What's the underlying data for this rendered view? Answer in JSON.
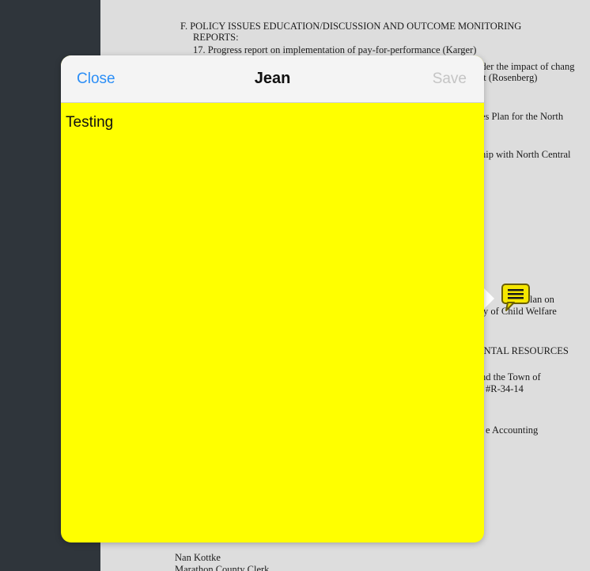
{
  "document": {
    "section_heading": "F.  POLICY ISSUES EDUCATION/DISCUSSION AND OUTCOME MONITORING",
    "section_heading_cont": "REPORTS:",
    "item_17": "17.  Progress report on implementation of pay-for-performance (Karger)",
    "frag_consider": "ider the impact of chang",
    "frag_rosenberg": "nt (Rosenberg)",
    "frag_plan_north": "es Plan for the North",
    "frag_north_central": "nip with North Central",
    "frag_plan_on": "lan on",
    "frag_child_welfare": "y of Child Welfare",
    "frag_resources": "ENTAL RESOURCES",
    "frag_town_of": "nd the Town of",
    "frag_resolution": "#R-34-14",
    "frag_accounting": "e Accounting",
    "signature_name": "Nan Kottke",
    "signature_title": "Marathon County Clerk"
  },
  "note_popup": {
    "close_label": "Close",
    "title": "Jean",
    "save_label": "Save",
    "body_text": "Testing",
    "background_color": "#ffff00"
  },
  "annotation_icon": {
    "icon": "comment-icon",
    "color": "#f5e600"
  }
}
